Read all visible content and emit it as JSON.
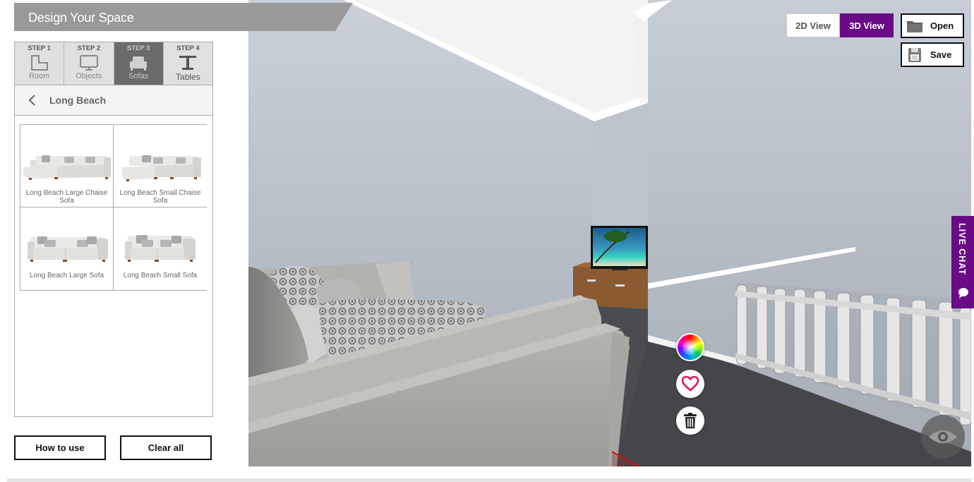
{
  "header": {
    "title": "Design Your Space"
  },
  "steps": [
    {
      "step": "STEP 1",
      "label": "Room",
      "icon": "room-icon",
      "active": false
    },
    {
      "step": "STEP 2",
      "label": "Objects",
      "icon": "tv-icon",
      "active": false
    },
    {
      "step": "STEP 3",
      "label": "Sofas",
      "icon": "sofa-icon",
      "active": true
    },
    {
      "step": "STEP 4",
      "label": "Tables",
      "icon": "table-icon",
      "active": false
    }
  ],
  "breadcrumb": {
    "back_icon": "chevron-left-icon",
    "title": "Long Beach"
  },
  "products": [
    {
      "name": "Long Beach Large Chaise Sofa"
    },
    {
      "name": "Long Beach Small Chaise Sofa"
    },
    {
      "name": "Long Beach Large Sofa"
    },
    {
      "name": "Long Beach Small Sofa"
    }
  ],
  "actions": {
    "how_to_use": "How to use",
    "clear_all": "Clear all"
  },
  "view_toggle": {
    "view_2d": "2D View",
    "view_3d": "3D View",
    "active": "3D View"
  },
  "file": {
    "open": "Open",
    "save": "Save"
  },
  "live_chat": {
    "label": "LIVE CHAT",
    "icon": "chat-bubble-icon"
  },
  "object_tools": [
    {
      "name": "color-wheel-icon"
    },
    {
      "name": "heart-icon"
    },
    {
      "name": "trash-icon"
    }
  ],
  "view_mode_icon": "eye-icon",
  "colors": {
    "accent": "#6a0a86",
    "banner": "#999999",
    "heart": "#e0185f",
    "active_step": "#6b6b6b"
  }
}
